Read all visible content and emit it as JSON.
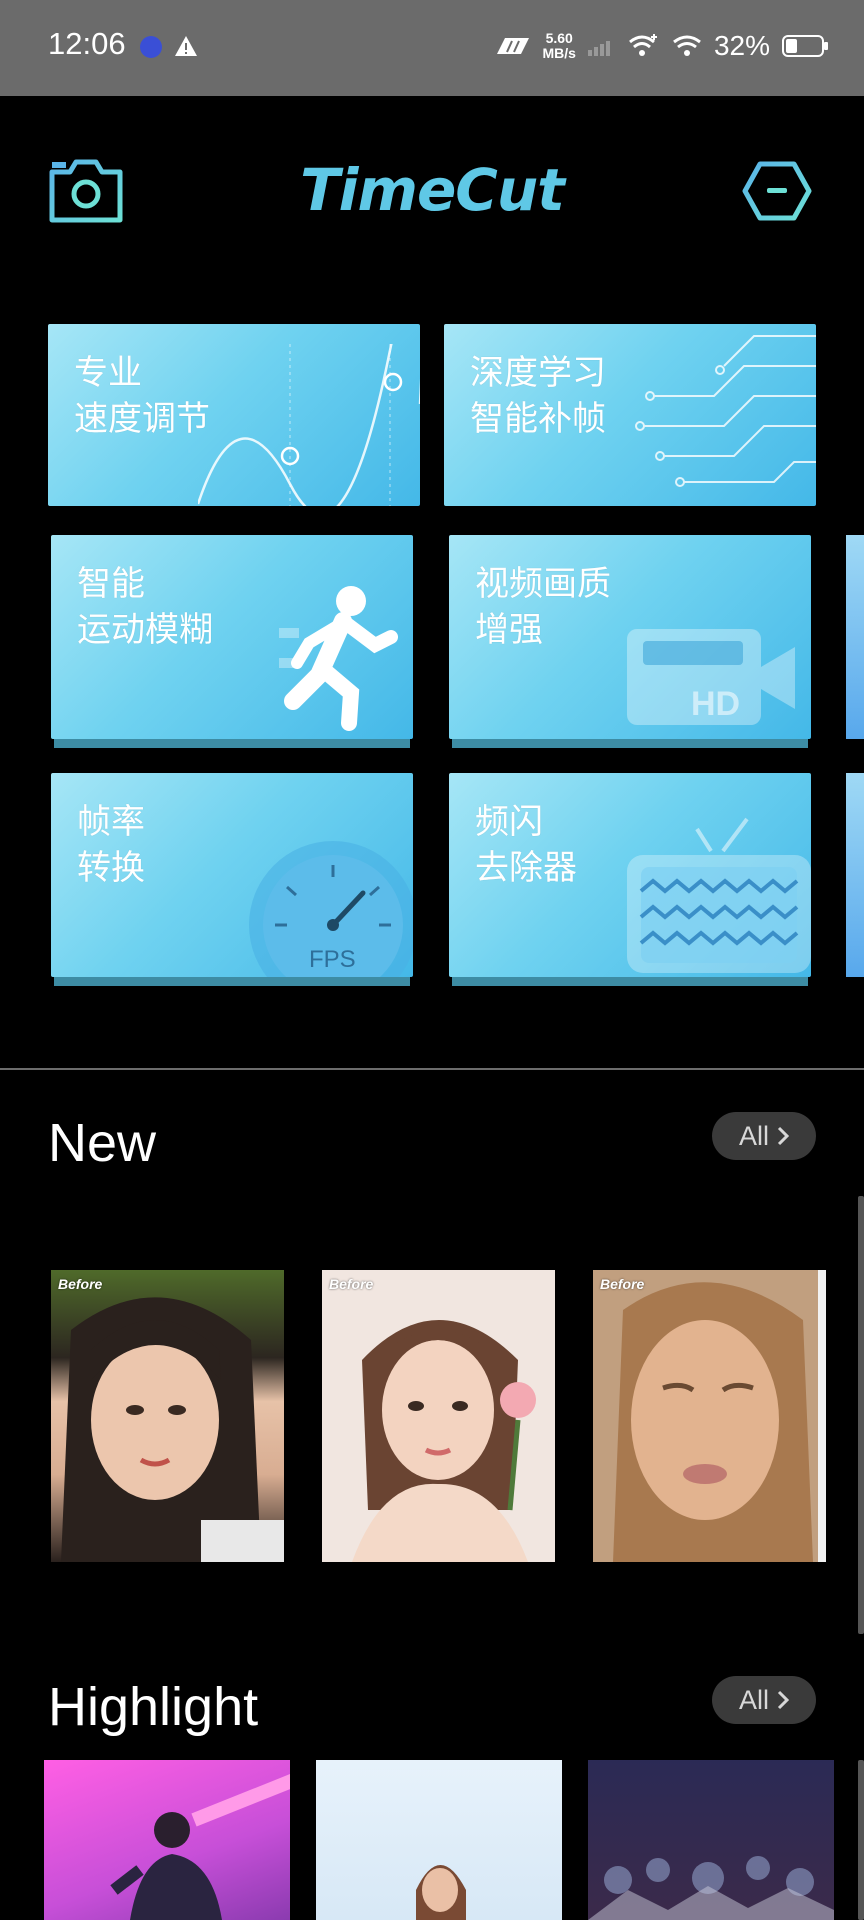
{
  "status_bar": {
    "time": "12:06",
    "net_speed_value": "5.60",
    "net_speed_unit": "MB/s",
    "battery_percent": "32%",
    "battery_level": 0.32
  },
  "header": {
    "title": "TimeCut",
    "camera_icon": "camera-icon",
    "menu_icon": "hexagon-menu-icon",
    "accent": "#5fc8e6"
  },
  "features": [
    {
      "label": "专业\n速度调节",
      "icon": "speed-curve-icon"
    },
    {
      "label": "深度学习\n智能补帧",
      "icon": "circuit-icon"
    },
    {
      "label": "智能\n运动模糊",
      "icon": "running-man-icon"
    },
    {
      "label": "视频画质\n增强",
      "icon": "hd-camera-icon",
      "badge": "HD"
    },
    {
      "label": "帧率\n转换",
      "icon": "fps-gauge-icon",
      "badge": "FPS"
    },
    {
      "label": "频闪\n去除器",
      "icon": "tv-icon"
    }
  ],
  "sections": {
    "new": {
      "title": "New",
      "all_label": "All",
      "items": [
        {
          "badge": "Before"
        },
        {
          "badge": "Before"
        },
        {
          "badge": "Before"
        }
      ]
    },
    "highlight": {
      "title": "Highlight",
      "all_label": "All"
    }
  }
}
